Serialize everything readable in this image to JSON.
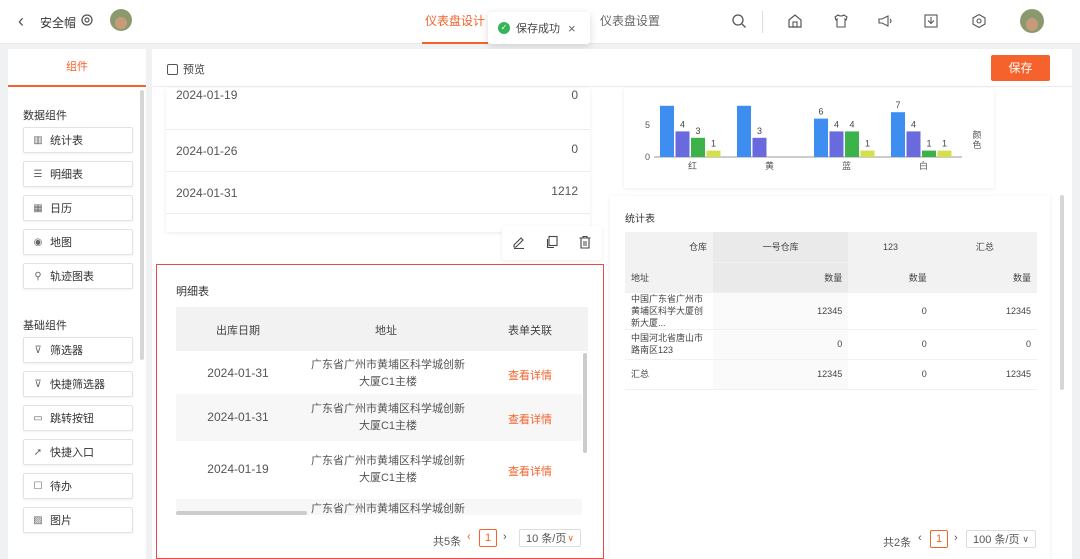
{
  "header": {
    "title": "安全帽",
    "tabs": [
      "仪表盘设计",
      "仪表盘设置"
    ],
    "toast": "保存成功"
  },
  "left_panel": {
    "tab": "组件",
    "data_section": "数据组件",
    "data_items": [
      {
        "label": "统计表",
        "icon": "bar-chart-icon"
      },
      {
        "label": "明细表",
        "icon": "list-icon"
      },
      {
        "label": "日历",
        "icon": "calendar-icon"
      },
      {
        "label": "地图",
        "icon": "map-pin-icon"
      },
      {
        "label": "轨迹图表",
        "icon": "track-icon"
      }
    ],
    "basic_section": "基础组件",
    "basic_items": [
      {
        "label": "筛选器",
        "icon": "filter-icon"
      },
      {
        "label": "快捷筛选器",
        "icon": "quick-filter-icon"
      },
      {
        "label": "跳转按钮",
        "icon": "jump-button-icon"
      },
      {
        "label": "快捷入口",
        "icon": "shortcut-icon"
      },
      {
        "label": "待办",
        "icon": "todo-icon"
      },
      {
        "label": "图片",
        "icon": "image-icon"
      }
    ]
  },
  "toolbar": {
    "preview": "预览",
    "save": "保存"
  },
  "top_table": {
    "rows": [
      {
        "date": "2024-01-19",
        "value": "0"
      },
      {
        "date": "2024-01-26",
        "value": "0"
      },
      {
        "date": "2024-01-31",
        "value": "1212"
      }
    ]
  },
  "detail_table": {
    "title": "明细表",
    "columns": [
      "出库日期",
      "地址",
      "表单关联"
    ],
    "rows": [
      {
        "date": "2024-01-31",
        "address": "广东省广州市黄埔区科学城创新大厦C1主楼",
        "link": "查看详情"
      },
      {
        "date": "2024-01-31",
        "address": "广东省广州市黄埔区科学城创新大厦C1主楼",
        "link": "查看详情"
      },
      {
        "date": "2024-01-19",
        "address": "广东省广州市黄埔区科学城创新大厦C1主楼",
        "link": "查看详情"
      },
      {
        "date": "",
        "address": "广东省广州市黄埔区科学城创新",
        "link": ""
      }
    ],
    "total": "共5条",
    "page": "1",
    "page_size": "10 条/页"
  },
  "bar_chart": {
    "type": "bar",
    "categories": [
      "红",
      "黄",
      "蓝",
      "白"
    ],
    "legend_label": "颜色",
    "y_ticks": [
      "0",
      "5"
    ],
    "ylim": [
      0,
      8
    ],
    "series": [
      {
        "color": "#3d8ef0",
        "values": [
          8,
          8,
          6,
          7
        ]
      },
      {
        "color": "#6a6adf",
        "values": [
          4,
          3,
          4,
          4
        ]
      },
      {
        "color": "#3cb24a",
        "values": [
          3,
          0,
          4,
          1
        ]
      },
      {
        "color": "#d4df4d",
        "values": [
          1,
          0,
          1,
          1
        ]
      }
    ],
    "labels": [
      [
        "",
        "4",
        "3",
        "1"
      ],
      [
        "",
        "3",
        "",
        ""
      ],
      [
        "6",
        "4",
        "4",
        "1"
      ],
      [
        "7",
        "4",
        "1",
        "1"
      ]
    ]
  },
  "stat_table": {
    "title": "统计表",
    "header1": [
      "仓库",
      "一号仓库",
      "123",
      "汇总"
    ],
    "header2": [
      "地址",
      "数量",
      "数量",
      "数量"
    ],
    "rows": [
      [
        "中国广东省广州市黄埔区科学大厦创新大厦...",
        "12345",
        "0",
        "12345"
      ],
      [
        "中国河北省唐山市路南区123",
        "0",
        "0",
        "0"
      ],
      [
        "汇总",
        "12345",
        "0",
        "12345"
      ]
    ],
    "total": "共2条",
    "page": "1",
    "page_size": "100 条/页"
  }
}
